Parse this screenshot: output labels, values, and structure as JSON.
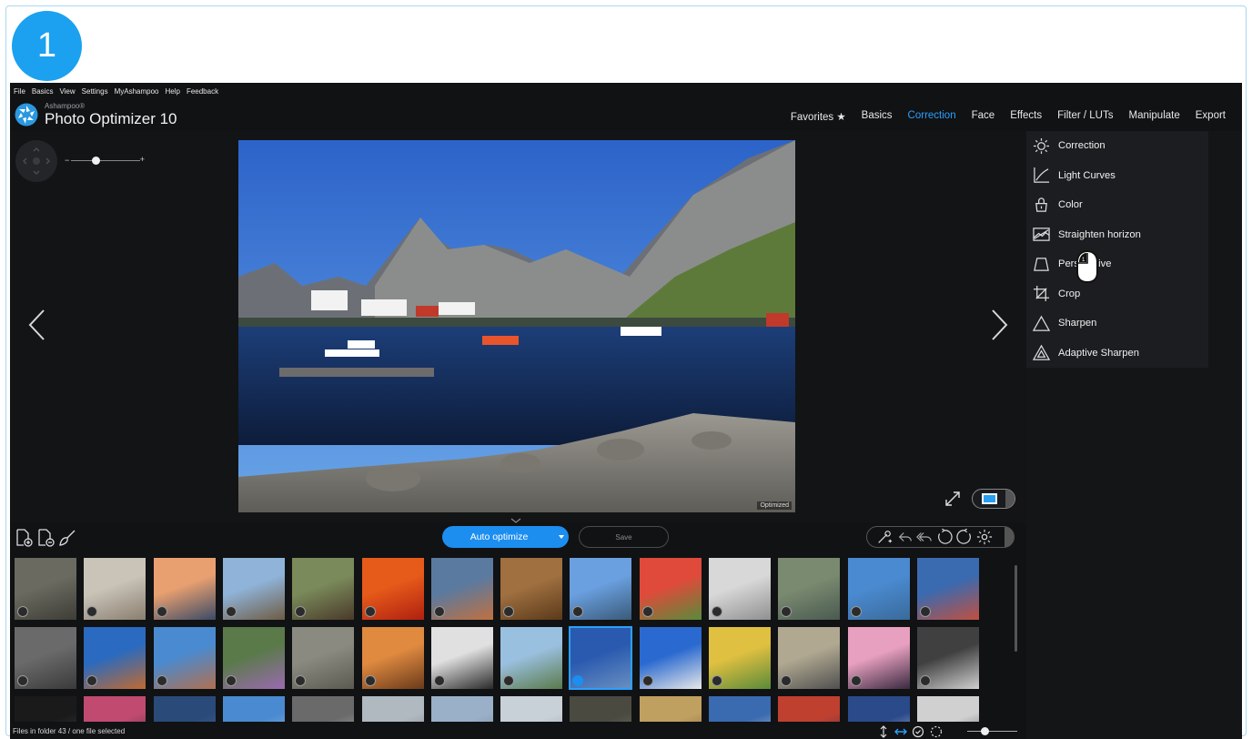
{
  "step_badge": "1",
  "menubar": [
    "File",
    "Basics",
    "View",
    "Settings",
    "MyAshampoo",
    "Help",
    "Feedback"
  ],
  "brand": {
    "company": "Ashampoo®",
    "product": "Photo Optimizer 10"
  },
  "navtabs": [
    {
      "label": "Favorites ★",
      "active": false
    },
    {
      "label": "Basics",
      "active": false
    },
    {
      "label": "Correction",
      "active": true
    },
    {
      "label": "Face",
      "active": false
    },
    {
      "label": "Effects",
      "active": false
    },
    {
      "label": "Filter / LUTs",
      "active": false
    },
    {
      "label": "Manipulate",
      "active": false
    },
    {
      "label": "Export",
      "active": false
    }
  ],
  "zoom": {
    "minus": "−",
    "plus": "+"
  },
  "photo": {
    "tag": "Optimized"
  },
  "tools": [
    {
      "label": "Correction",
      "icon": "sun-icon"
    },
    {
      "label": "Light Curves",
      "icon": "curve-icon"
    },
    {
      "label": "Color",
      "icon": "paint-bucket-icon"
    },
    {
      "label": "Straighten horizon",
      "icon": "horizon-icon"
    },
    {
      "label": "Perspective",
      "icon": "perspective-icon"
    },
    {
      "label": "Crop",
      "icon": "crop-icon"
    },
    {
      "label": "Sharpen",
      "icon": "triangle-icon"
    },
    {
      "label": "Adaptive Sharpen",
      "icon": "adaptive-triangle-icon"
    }
  ],
  "toolbar": {
    "auto_optimize": "Auto optimize",
    "save": "Save"
  },
  "status": {
    "text": "Files in folder 43 / one file selected"
  },
  "colors": {
    "accent": "#1c8ef0",
    "active_tab": "#2aa0ff",
    "badge": "#1ba1ef",
    "app_bg": "#111214"
  }
}
